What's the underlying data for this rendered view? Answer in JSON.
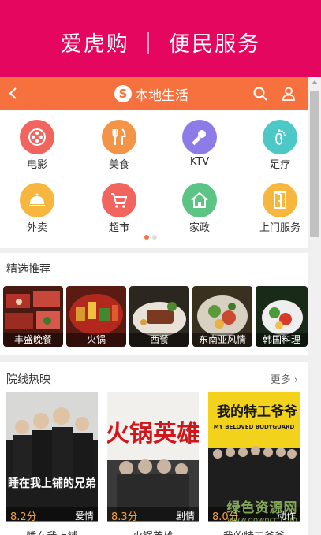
{
  "banner": {
    "title": "爱虎购 ｜ 便民服务"
  },
  "topbar": {
    "brand_logo": "S",
    "title": "本地生活"
  },
  "services": [
    {
      "label": "电影",
      "icon": "film-reel-icon",
      "color": "#f2655f"
    },
    {
      "label": "美食",
      "icon": "fork-knife-icon",
      "color": "#f39447"
    },
    {
      "label": "KTV",
      "icon": "microphone-icon",
      "color": "#8d7ce7"
    },
    {
      "label": "足疗",
      "icon": "footprint-icon",
      "color": "#4cc9c6"
    },
    {
      "label": "外卖",
      "icon": "cloche-icon",
      "color": "#f7b73e"
    },
    {
      "label": "超市",
      "icon": "shopping-cart-icon",
      "color": "#f2655f"
    },
    {
      "label": "家政",
      "icon": "house-icon",
      "color": "#5cc585"
    },
    {
      "label": "上门服务",
      "icon": "door-icon",
      "color": "#f7b73e"
    }
  ],
  "picks": {
    "title": "精选推荐",
    "items": [
      {
        "label": "丰盛晚餐"
      },
      {
        "label": "火锅"
      },
      {
        "label": "西餐"
      },
      {
        "label": "东南亚风情"
      },
      {
        "label": "韩国料理"
      }
    ]
  },
  "movies": {
    "title": "院线热映",
    "more": "更多",
    "items": [
      {
        "score": "8.2分",
        "genre": "爱情",
        "title": "睡在我上铺",
        "poster_text": "睡在我上铺的兄弟"
      },
      {
        "score": "8.3分",
        "genre": "剧情",
        "title": "火锅英雄",
        "poster_text": "火锅英雄"
      },
      {
        "score": "8.0分",
        "genre": "动作",
        "title": "我的特工爷爷",
        "poster_text": "我的特工爷爷",
        "poster_subtitle": "MY BELOVED BODYGUARD"
      }
    ]
  },
  "watermark": {
    "line1": "绿色资源网",
    "line2": "www.downcc.com"
  }
}
